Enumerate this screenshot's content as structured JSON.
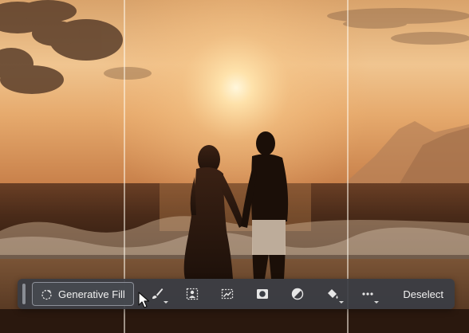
{
  "taskbar": {
    "generative_fill_label": "Generative Fill",
    "deselect_label": "Deselect",
    "tools": [
      {
        "icon": "brush-icon",
        "has_dropdown": true
      },
      {
        "icon": "select-subject-icon",
        "has_dropdown": false
      },
      {
        "icon": "transform-selection-icon",
        "has_dropdown": false
      },
      {
        "icon": "mask-icon",
        "has_dropdown": false
      },
      {
        "icon": "adjustment-layer-icon",
        "has_dropdown": false
      },
      {
        "icon": "fill-bucket-icon",
        "has_dropdown": true
      },
      {
        "icon": "more-options-icon",
        "has_dropdown": true
      }
    ]
  },
  "colors": {
    "sky_top": "#f3c891",
    "sun": "#fff3cf",
    "sea": "#3b2416",
    "taskbar_bg": "#3a3d44",
    "text": "#f1f1f1"
  }
}
